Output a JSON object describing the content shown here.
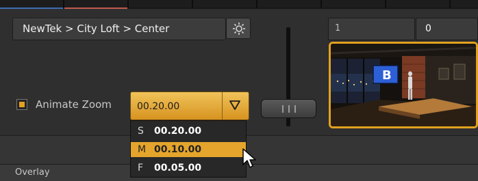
{
  "breadcrumb": {
    "text": "NewTek > City Loft > Center"
  },
  "settings": {
    "icon": "gear-icon"
  },
  "animate_zoom": {
    "label": "Animate Zoom",
    "checked": true
  },
  "zoom": {
    "value": "00.20.00",
    "options": [
      {
        "key": "S",
        "value": "00.20.00"
      },
      {
        "key": "M",
        "value": "00.10.00",
        "highlighted": true
      },
      {
        "key": "F",
        "value": "00.05.00"
      }
    ]
  },
  "preview": {
    "field_1": "1",
    "field_2": "0",
    "thumbnail_letter": "B"
  },
  "overlay": {
    "label": "Overlay"
  },
  "colors": {
    "accent": "#e3a11f",
    "tab_blue": "#3d6cb3",
    "tab_red": "#c25a4a"
  }
}
